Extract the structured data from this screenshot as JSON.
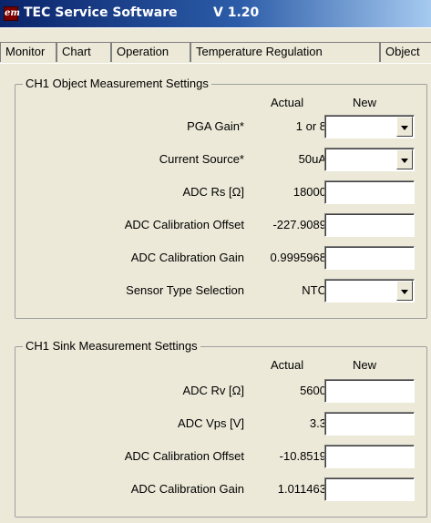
{
  "window": {
    "title": "TEC Service Software",
    "version": "V 1.20",
    "icon_text": "em"
  },
  "tabs": [
    {
      "label": "Monitor"
    },
    {
      "label": "Chart"
    },
    {
      "label": "Operation"
    },
    {
      "label": "Temperature Regulation"
    },
    {
      "label": "Object"
    }
  ],
  "object_group": {
    "title": "CH1 Object Measurement Settings",
    "col_actual": "Actual",
    "col_new": "New",
    "rows": [
      {
        "label": "PGA Gain*",
        "actual": "1 or 8",
        "new": "",
        "type": "dropdown"
      },
      {
        "label": "Current Source*",
        "actual": "50uA",
        "new": "",
        "type": "dropdown"
      },
      {
        "label": "ADC Rs [Ω]",
        "actual": "18000",
        "new": "",
        "type": "text"
      },
      {
        "label": "ADC Calibration Offset",
        "actual": "-227.9089",
        "new": "",
        "type": "text"
      },
      {
        "label": "ADC Calibration Gain",
        "actual": "0.9995968",
        "new": "",
        "type": "text"
      },
      {
        "label": "Sensor Type Selection",
        "actual": "NTC",
        "new": "",
        "type": "dropdown"
      }
    ]
  },
  "sink_group": {
    "title": "CH1 Sink Measurement Settings",
    "col_actual": "Actual",
    "col_new": "New",
    "rows": [
      {
        "label": "ADC Rv [Ω]",
        "actual": "5600",
        "new": "",
        "type": "text"
      },
      {
        "label": "ADC Vps [V]",
        "actual": "3.3",
        "new": "",
        "type": "text"
      },
      {
        "label": "ADC Calibration Offset",
        "actual": "-10.8519",
        "new": "",
        "type": "text"
      },
      {
        "label": "ADC Calibration Gain",
        "actual": "1.011463",
        "new": "",
        "type": "text"
      }
    ]
  },
  "icons": {
    "app": "app-logo-icon",
    "dropdown": "chevron-down-icon"
  },
  "colors": {
    "titlebar_start": "#0a246a",
    "titlebar_end": "#a6caf0",
    "face": "#ece9d8"
  }
}
